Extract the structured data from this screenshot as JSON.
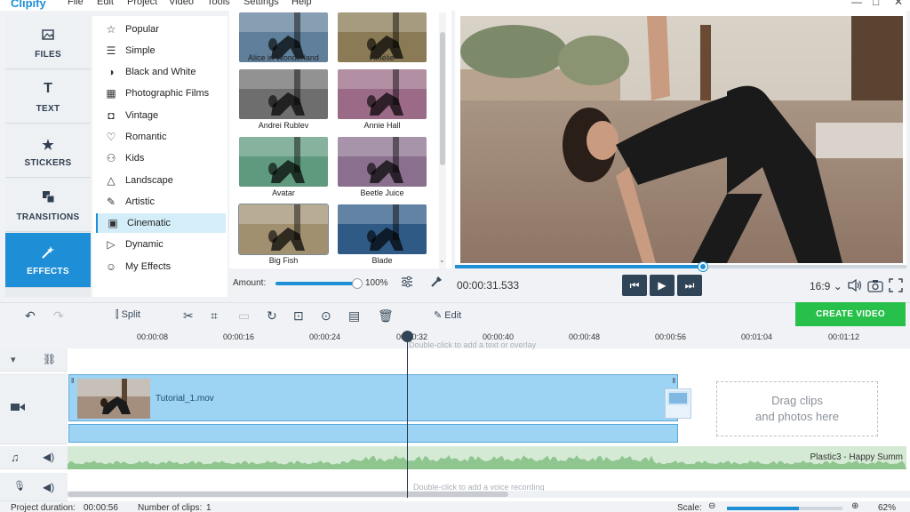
{
  "app": {
    "name": "Clipify"
  },
  "menu": [
    "File",
    "Edit",
    "Project",
    "Video",
    "Tools",
    "Settings",
    "Help"
  ],
  "window_controls": [
    "—",
    "□",
    "✕"
  ],
  "nav": [
    {
      "label": "FILES",
      "icon": "files-icon"
    },
    {
      "label": "TEXT",
      "icon": "text-icon"
    },
    {
      "label": "STICKERS",
      "icon": "star-icon"
    },
    {
      "label": "TRANSITIONS",
      "icon": "transitions-icon"
    },
    {
      "label": "EFFECTS",
      "icon": "effects-icon",
      "active": true
    }
  ],
  "categories": [
    {
      "label": "Popular",
      "icon": "star-outline-icon"
    },
    {
      "label": "Simple",
      "icon": "list-icon"
    },
    {
      "label": "Black and White",
      "icon": "contrast-icon"
    },
    {
      "label": "Photographic Films",
      "icon": "film-icon"
    },
    {
      "label": "Vintage",
      "icon": "camera-icon"
    },
    {
      "label": "Romantic",
      "icon": "heart-icon"
    },
    {
      "label": "Kids",
      "icon": "kids-icon"
    },
    {
      "label": "Landscape",
      "icon": "mountain-icon"
    },
    {
      "label": "Artistic",
      "icon": "artistic-icon"
    },
    {
      "label": "Cinematic",
      "icon": "cinematic-icon",
      "active": true
    },
    {
      "label": "Dynamic",
      "icon": "play-circle-icon"
    },
    {
      "label": "My Effects",
      "icon": "user-icon"
    }
  ],
  "filters": [
    {
      "label": "Alice in Wonderland",
      "tint": "#5f7f9a"
    },
    {
      "label": "Amélie",
      "tint": "#8a7a55"
    },
    {
      "label": "Andrei Rublev",
      "tint": "#6e6e6e"
    },
    {
      "label": "Annie Hall",
      "tint": "#9a6a86"
    },
    {
      "label": "Avatar",
      "tint": "#5f9a7e"
    },
    {
      "label": "Beetle Juice",
      "tint": "#8a6f8e"
    },
    {
      "label": "Big Fish",
      "tint": "#a09070",
      "selected": true
    },
    {
      "label": "Blade",
      "tint": "#2f5a86"
    }
  ],
  "amount": {
    "label": "Amount:",
    "value": "100%",
    "fraction": 1.0
  },
  "player": {
    "time": "00:00:31.533",
    "progress": 0.55,
    "aspect": "16:9",
    "aspect_chevron": "⌄",
    "prev_icon": "⏮",
    "play_icon": "▶",
    "next_icon": "⏭"
  },
  "toolbar": {
    "split": "Split",
    "edit": "Edit",
    "create": "CREATE VIDEO"
  },
  "ruler": [
    "00:00:08",
    "00:00:16",
    "00:00:24",
    "00:00:32",
    "00:00:40",
    "00:00:48",
    "00:00:56",
    "00:01:04",
    "00:01:12"
  ],
  "timeline": {
    "top_hint": "Double-click to add a text or overlay",
    "clip_name": "Tutorial_1.mov",
    "drag_line1": "Drag clips",
    "drag_line2": "and photos here",
    "audio_name": "Plastic3 - Happy Summ",
    "voice_hint": "Double-click to add a voice recording"
  },
  "status": {
    "duration_label": "Project duration:",
    "duration_value": "00:00:56",
    "clips_label": "Number of clips:",
    "clips_value": "1",
    "scale_label": "Scale:",
    "scale_value": "62%",
    "scale_fraction": 0.62
  },
  "colors": {
    "accent": "#1e8fd6",
    "create": "#27c04a",
    "dark_button": "#2f4457",
    "clip": "#9dd3f3"
  }
}
